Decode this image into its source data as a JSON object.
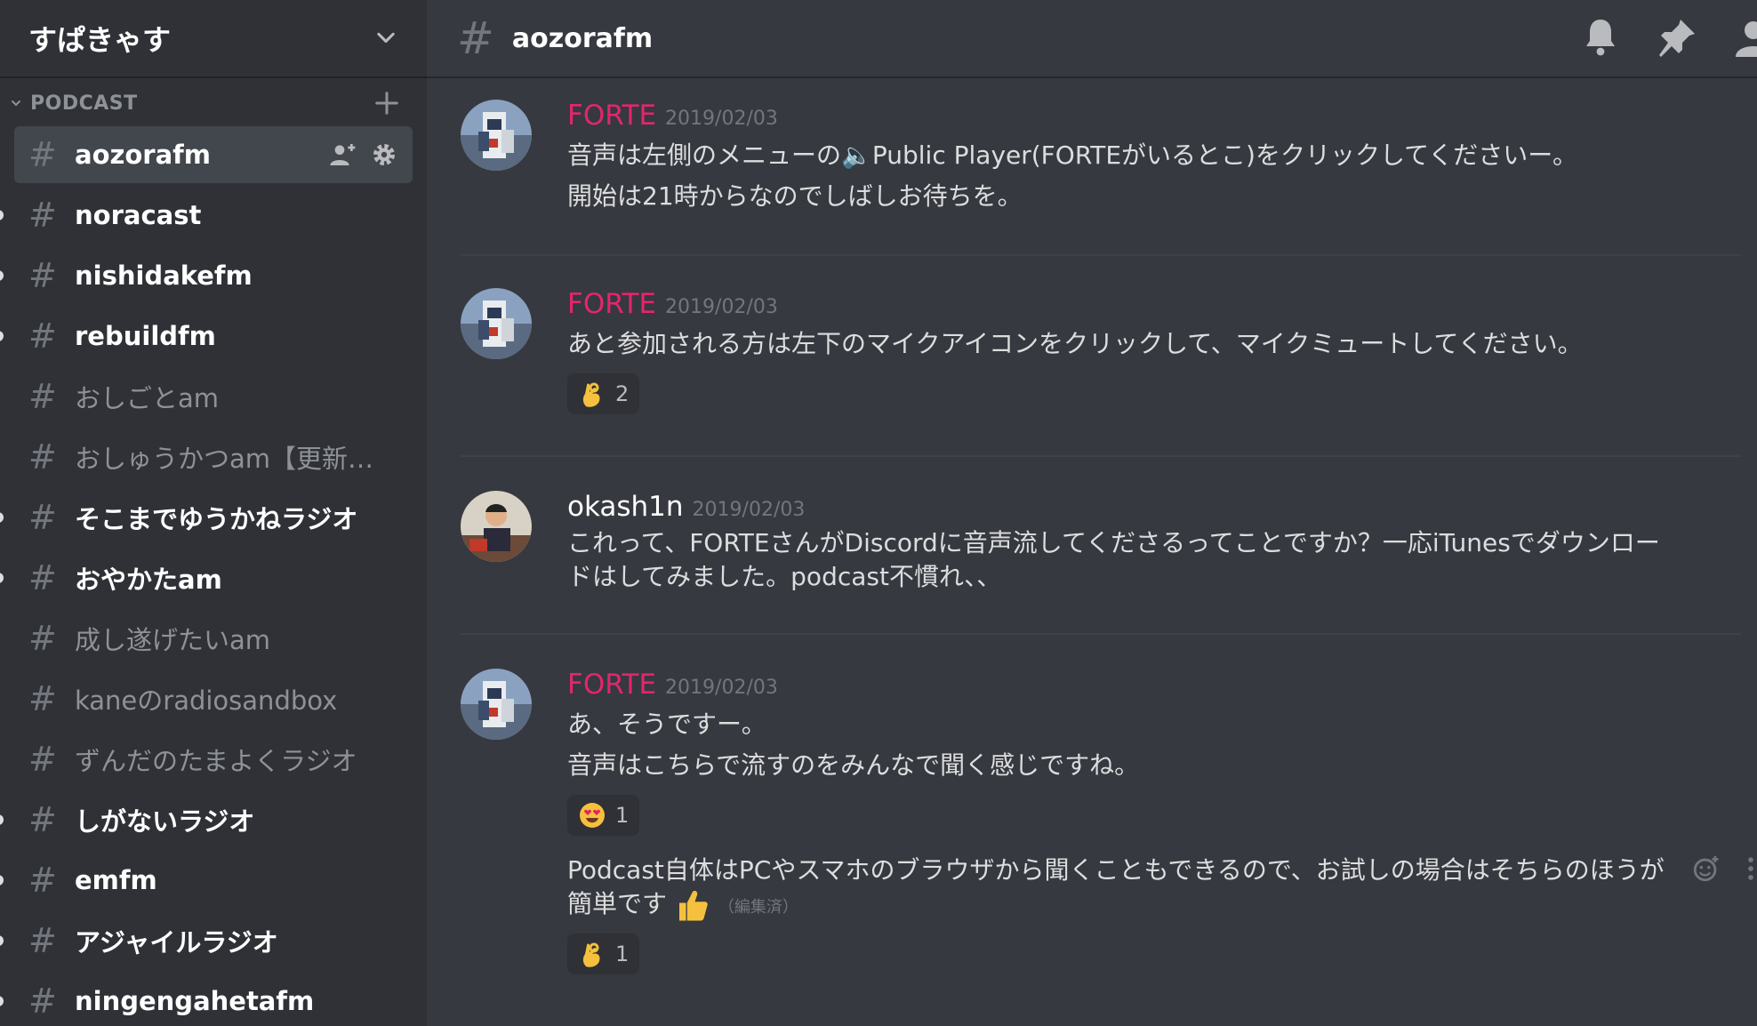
{
  "server": {
    "name": "すぱきゃす"
  },
  "category": {
    "name": "PODCAST"
  },
  "channels": [
    {
      "name": "aozorafm",
      "state": "active"
    },
    {
      "name": "noracast",
      "state": "unread"
    },
    {
      "name": "nishidakefm",
      "state": "unread"
    },
    {
      "name": "rebuildfm",
      "state": "unread"
    },
    {
      "name": "おしごとam",
      "state": "read"
    },
    {
      "name": "おしゅうかつam【更新…",
      "state": "read"
    },
    {
      "name": "そこまでゆうかねラジオ",
      "state": "unread"
    },
    {
      "name": "おやかたam",
      "state": "unread"
    },
    {
      "name": "成し遂げたいam",
      "state": "read"
    },
    {
      "name": "kaneのradiosandbox",
      "state": "read"
    },
    {
      "name": "ずんだのたまよくラジオ",
      "state": "read"
    },
    {
      "name": "しがないラジオ",
      "state": "unread"
    },
    {
      "name": "emfm",
      "state": "unread"
    },
    {
      "name": "アジャイルラジオ",
      "state": "unread"
    },
    {
      "name": "ningengahetafm",
      "state": "unread"
    }
  ],
  "channel_header": {
    "hash": "#",
    "title": "aozorafm"
  },
  "icons": {
    "top": [
      "bell-icon",
      "pin-icon",
      "members-icon"
    ],
    "channel_tools": [
      "invite-icon",
      "settings-icon"
    ]
  },
  "colors": {
    "forte": "#e2266d",
    "sidebar": "#2f3136",
    "main": "#36393f"
  },
  "messages": [
    {
      "author": "FORTE",
      "timestamp": "2019/02/03",
      "lines": [
        "音声は左側のメニューの🔈Public Player(FORTEがいるとこ)をクリックしてくださいー。",
        "開始は21時からなのでしばしお待ちを。"
      ]
    },
    {
      "author": "FORTE",
      "timestamp": "2019/02/03",
      "lines": [
        "あと参加される方は左下のマイクアイコンをクリックして、マイクミュートしてください。"
      ],
      "reaction": {
        "emoji": "ok-hand",
        "count": "2"
      }
    },
    {
      "author": "okash1n",
      "timestamp": "2019/02/03",
      "lines": [
        "これって、FORTEさんがDiscordに音声流してくださるってことですか？一応iTunesでダウンロードはしてみました。podcast不慣れ、、"
      ]
    },
    {
      "author": "FORTE",
      "timestamp": "2019/02/03",
      "lines": [
        "あ、そうですー。",
        "音声はこちらで流すのをみんなで聞く感じですね。"
      ],
      "reaction": {
        "emoji": "heart-eyes",
        "count": "1"
      },
      "followup": {
        "text": "Podcast自体はPCやスマホのブラウザから聞くこともできるので、お試しの場合はそちらのほうが簡単です",
        "edited": "（編集済）",
        "reaction": {
          "emoji": "ok-hand",
          "count": "1"
        }
      }
    }
  ]
}
